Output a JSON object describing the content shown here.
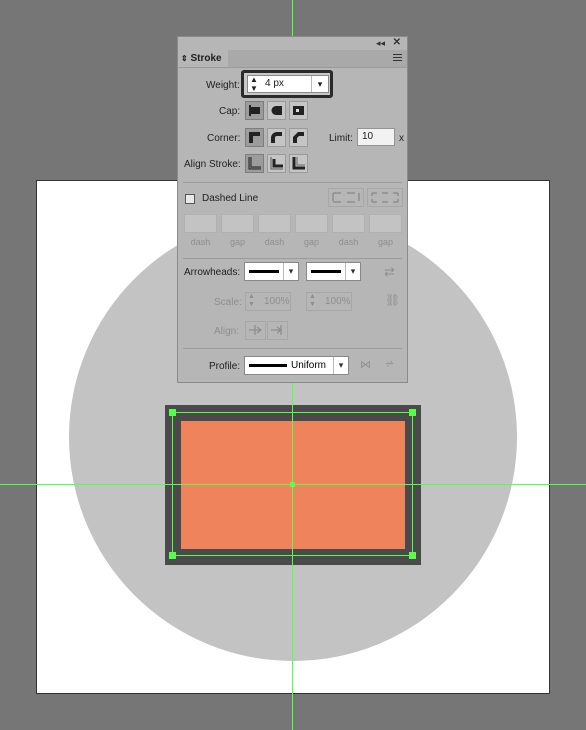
{
  "canvas": {
    "colors": {
      "pasteboard": "#767676",
      "artboard": "#ffffff",
      "circle": "#c3c3c3",
      "stroke": "#4a4a4a",
      "fill": "#ef845c",
      "guide": "#58ff4a"
    }
  },
  "panel": {
    "collapse_icon": "double-chevron-left-icon",
    "close_icon": "close-icon",
    "tab_label": "Stroke",
    "weight": {
      "label": "Weight:",
      "value": "4 px"
    },
    "cap": {
      "label": "Cap:"
    },
    "corner": {
      "label": "Corner:",
      "limit_label": "Limit:",
      "limit_value": "10",
      "limit_suffix": "x"
    },
    "align_stroke": {
      "label": "Align Stroke:"
    },
    "dashed_line": {
      "label": "Dashed Line",
      "checked": false
    },
    "dash_gap_labels": [
      "dash",
      "gap",
      "dash",
      "gap",
      "dash",
      "gap"
    ],
    "arrowheads": {
      "label": "Arrowheads:"
    },
    "scale": {
      "label": "Scale:",
      "start": "100%",
      "end": "100%"
    },
    "align": {
      "label": "Align:"
    },
    "profile": {
      "label": "Profile:",
      "value": "Uniform"
    }
  }
}
